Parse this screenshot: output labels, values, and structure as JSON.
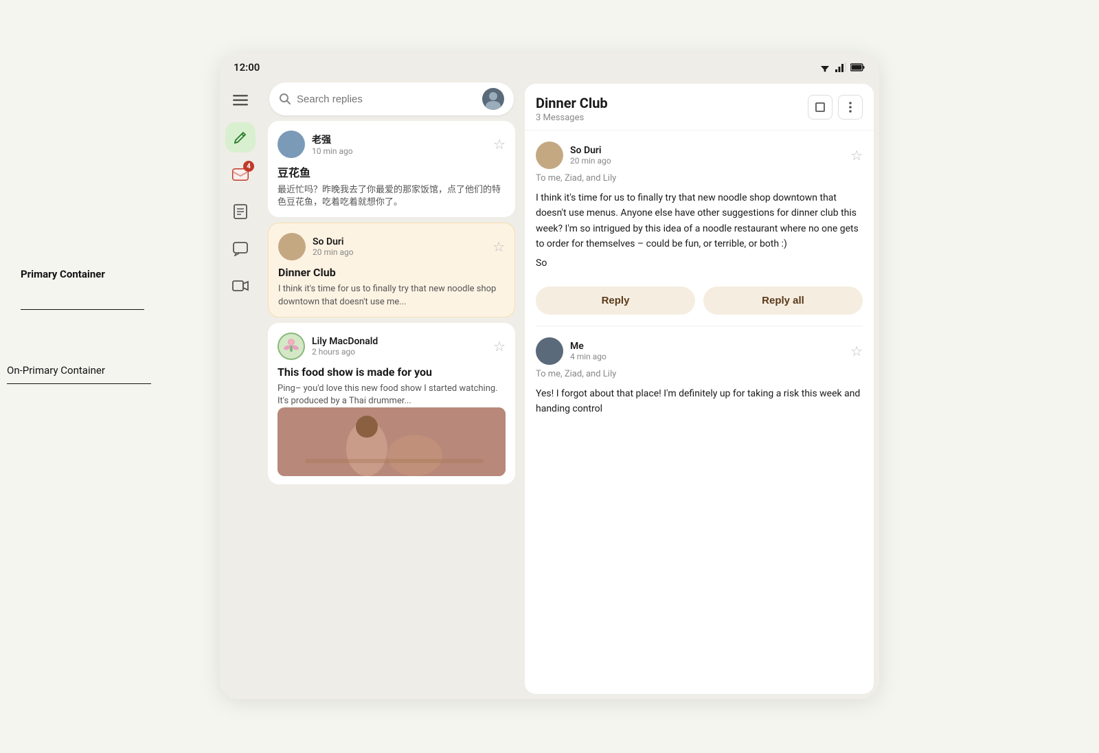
{
  "status_bar": {
    "time": "12:00",
    "wifi": "wifi",
    "signal": "signal",
    "battery": "battery"
  },
  "sidebar": {
    "icons": [
      {
        "name": "hamburger-menu",
        "symbol": "☰"
      },
      {
        "name": "compose",
        "symbol": "✏️"
      },
      {
        "name": "inbox",
        "symbol": "📥",
        "badge": "4"
      },
      {
        "name": "document",
        "symbol": "≡"
      },
      {
        "name": "chat",
        "symbol": "□"
      },
      {
        "name": "video",
        "symbol": "🎥"
      }
    ]
  },
  "search": {
    "placeholder": "Search replies"
  },
  "email_list": {
    "items": [
      {
        "id": "email-1",
        "sender": "老强",
        "time": "10 min ago",
        "subject": "豆花鱼",
        "preview": "最近忙吗？昨晚我去了你最爱的那家饭馆，点了他们的特色豆花鱼，吃着吃着就想你了。",
        "avatar_color": "av-blue",
        "selected": false
      },
      {
        "id": "email-2",
        "sender": "So Duri",
        "time": "20 min ago",
        "subject": "Dinner Club",
        "preview": "I think it's time for us to finally try that new noodle shop downtown that doesn't use me...",
        "avatar_color": "av-tan",
        "selected": true
      },
      {
        "id": "email-3",
        "sender": "Lily MacDonald",
        "time": "2 hours ago",
        "subject": "This food show is made for you",
        "preview": "Ping– you'd love this new food show I started watching. It's produced by a Thai drummer...",
        "avatar_color": "av-green",
        "has_image": true,
        "selected": false
      }
    ]
  },
  "detail": {
    "title": "Dinner Club",
    "message_count": "3 Messages",
    "messages": [
      {
        "id": "msg-1",
        "sender": "So Duri",
        "time": "20 min ago",
        "to": "To me, Ziad, and Lily",
        "body": "I think it's time for us to finally try that new noodle shop downtown that doesn't use menus. Anyone else have other suggestions for dinner club this week? I'm so intrigued by this idea of a noodle restaurant where no one gets to order for themselves – could be fun, or terrible, or both :)",
        "sign": "So",
        "avatar_color": "av-tan",
        "show_reply": true
      },
      {
        "id": "msg-2",
        "sender": "Me",
        "time": "4 min ago",
        "to": "To me, Ziad, and Lily",
        "body": "Yes! I forgot about that place! I'm definitely up for taking a risk this week and handing control",
        "avatar_color": "av-dark",
        "show_reply": false
      }
    ],
    "reply_label": "Reply",
    "reply_all_label": "Reply all"
  },
  "annotations": {
    "primary_container": "Primary Container",
    "on_primary_container": "On-Primary Container"
  }
}
